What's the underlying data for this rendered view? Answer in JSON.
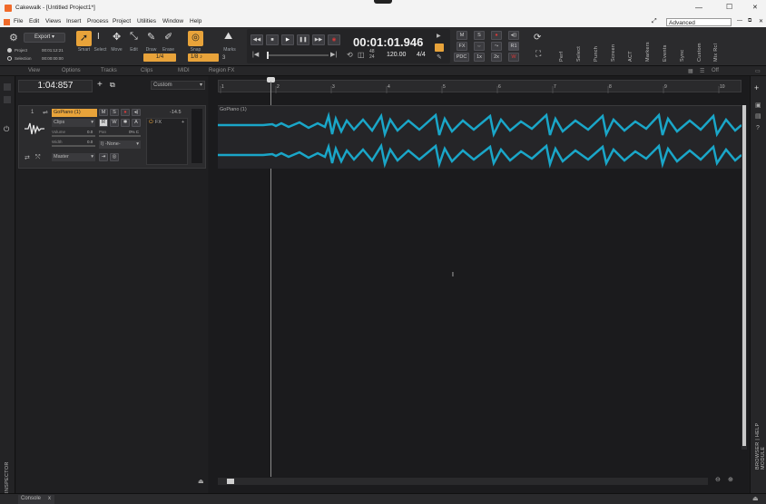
{
  "app": {
    "title": "Cakewalk - [Untitled Project1*]",
    "workspace": "Advanced",
    "controls": {
      "minimize": "—",
      "maximize": "☐",
      "close": "✕"
    }
  },
  "menu": [
    "File",
    "Edit",
    "Views",
    "Insert",
    "Process",
    "Project",
    "Utilities",
    "Window",
    "Help"
  ],
  "control_bar": {
    "export_label": "Export",
    "project_label": "Project",
    "project_time": "00:01:12:21",
    "selection_label": "Selection",
    "selection_time": "00:00:00:00",
    "tools": [
      "Smart",
      "Select",
      "Move",
      "Edit",
      "Draw",
      "Erase"
    ],
    "snap_label": "Snap",
    "snap_value": "1/8",
    "marks_label": "Marks",
    "marks_value": "3",
    "grid_value": "1/4",
    "time_display": "00:01:01.946",
    "sample_rate_top": "48",
    "sample_rate_bottom": "24",
    "tempo": "120.00",
    "meter": "4/4",
    "mix_buttons": [
      "M",
      "S",
      "●",
      "FX",
      "PDC",
      "1x",
      "2x"
    ],
    "module_labels": [
      "Perf",
      "Select",
      "Punch",
      "Screen",
      "ACT",
      "Markers",
      "Events",
      "Sync",
      "Custom",
      "Mix Rcl"
    ]
  },
  "view_menu": [
    "View",
    "Options",
    "Tracks",
    "Clips",
    "MIDI",
    "Region FX"
  ],
  "track_pane": {
    "now_time": "1:04:857",
    "preset": "Custom",
    "track": {
      "number": "1",
      "name": "GoPiano (1)",
      "volume_db": "-14.5",
      "clips_mode": "Clips",
      "volume_label": "Volume",
      "volume_value": "0.0",
      "pan_label": "Pan",
      "pan_value": "0% C",
      "width_label": "Width",
      "width_value": "0.0",
      "input": "I) -None-",
      "output": "Master",
      "fx_label": "FX"
    }
  },
  "timeline": {
    "ruler_marks": [
      "1",
      "2",
      "3",
      "4",
      "5",
      "6",
      "7",
      "8",
      "9",
      "10"
    ],
    "clip_name": "GoPiano (1)"
  },
  "right_panel": {
    "label": "BROWSER | HELP MODULE"
  },
  "left_panel": {
    "label": "INSPECTOR"
  },
  "bottom": {
    "tab": "Console",
    "close": "x"
  },
  "colors": {
    "waveform": "#1aa6c8",
    "accent": "#e8a33a",
    "record": "#d83a3a"
  }
}
